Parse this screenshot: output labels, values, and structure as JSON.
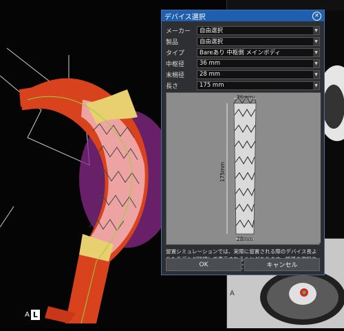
{
  "dialog": {
    "title": "デバイス選択",
    "fields": [
      {
        "label": "メーカー",
        "value": "自由選択"
      },
      {
        "label": "製品",
        "value": "自由選択"
      },
      {
        "label": "タイプ",
        "value": "Bareあり 中枢側 メインボディ"
      },
      {
        "label": "中枢径",
        "value": "36 mm"
      },
      {
        "label": "末梢径",
        "value": "28 mm"
      },
      {
        "label": "長さ",
        "value": "175 mm"
      }
    ],
    "preview": {
      "top_width": "36mm",
      "bottom_width": "28mm",
      "length": "175mm"
    },
    "note": "留置シミュレーションでは、実際に留置される際のデバイス長よりもモデルが短縮して表示されることがあります。機種の選択や施術にあたってはこの点に十分ご注意ください。",
    "ok_label": "OK",
    "cancel_label": "キャンセル"
  },
  "viewport": {
    "orientation_a": "A",
    "orientation_l": "L",
    "panel_label": "A"
  }
}
